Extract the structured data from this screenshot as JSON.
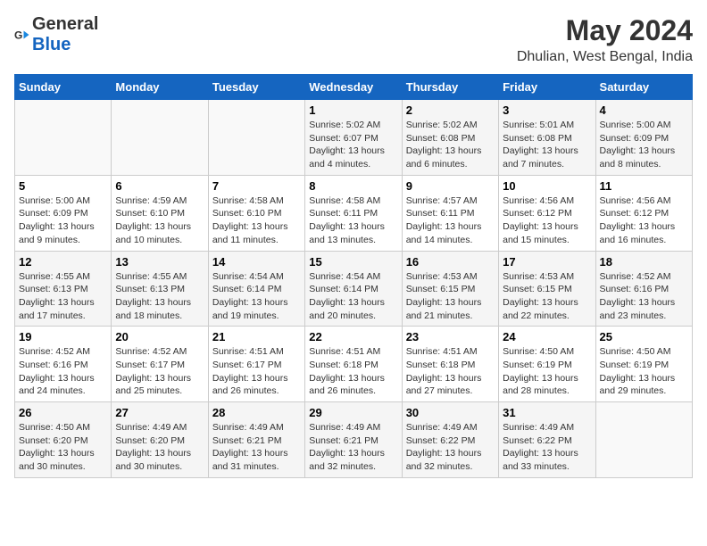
{
  "logo": {
    "line1": "General",
    "line2": "Blue"
  },
  "title": "May 2024",
  "subtitle": "Dhulian, West Bengal, India",
  "days_of_week": [
    "Sunday",
    "Monday",
    "Tuesday",
    "Wednesday",
    "Thursday",
    "Friday",
    "Saturday"
  ],
  "weeks": [
    [
      {
        "day": "",
        "info": ""
      },
      {
        "day": "",
        "info": ""
      },
      {
        "day": "",
        "info": ""
      },
      {
        "day": "1",
        "sunrise": "Sunrise: 5:02 AM",
        "sunset": "Sunset: 6:07 PM",
        "daylight": "Daylight: 13 hours and 4 minutes."
      },
      {
        "day": "2",
        "sunrise": "Sunrise: 5:02 AM",
        "sunset": "Sunset: 6:08 PM",
        "daylight": "Daylight: 13 hours and 6 minutes."
      },
      {
        "day": "3",
        "sunrise": "Sunrise: 5:01 AM",
        "sunset": "Sunset: 6:08 PM",
        "daylight": "Daylight: 13 hours and 7 minutes."
      },
      {
        "day": "4",
        "sunrise": "Sunrise: 5:00 AM",
        "sunset": "Sunset: 6:09 PM",
        "daylight": "Daylight: 13 hours and 8 minutes."
      }
    ],
    [
      {
        "day": "5",
        "sunrise": "Sunrise: 5:00 AM",
        "sunset": "Sunset: 6:09 PM",
        "daylight": "Daylight: 13 hours and 9 minutes."
      },
      {
        "day": "6",
        "sunrise": "Sunrise: 4:59 AM",
        "sunset": "Sunset: 6:10 PM",
        "daylight": "Daylight: 13 hours and 10 minutes."
      },
      {
        "day": "7",
        "sunrise": "Sunrise: 4:58 AM",
        "sunset": "Sunset: 6:10 PM",
        "daylight": "Daylight: 13 hours and 11 minutes."
      },
      {
        "day": "8",
        "sunrise": "Sunrise: 4:58 AM",
        "sunset": "Sunset: 6:11 PM",
        "daylight": "Daylight: 13 hours and 13 minutes."
      },
      {
        "day": "9",
        "sunrise": "Sunrise: 4:57 AM",
        "sunset": "Sunset: 6:11 PM",
        "daylight": "Daylight: 13 hours and 14 minutes."
      },
      {
        "day": "10",
        "sunrise": "Sunrise: 4:56 AM",
        "sunset": "Sunset: 6:12 PM",
        "daylight": "Daylight: 13 hours and 15 minutes."
      },
      {
        "day": "11",
        "sunrise": "Sunrise: 4:56 AM",
        "sunset": "Sunset: 6:12 PM",
        "daylight": "Daylight: 13 hours and 16 minutes."
      }
    ],
    [
      {
        "day": "12",
        "sunrise": "Sunrise: 4:55 AM",
        "sunset": "Sunset: 6:13 PM",
        "daylight": "Daylight: 13 hours and 17 minutes."
      },
      {
        "day": "13",
        "sunrise": "Sunrise: 4:55 AM",
        "sunset": "Sunset: 6:13 PM",
        "daylight": "Daylight: 13 hours and 18 minutes."
      },
      {
        "day": "14",
        "sunrise": "Sunrise: 4:54 AM",
        "sunset": "Sunset: 6:14 PM",
        "daylight": "Daylight: 13 hours and 19 minutes."
      },
      {
        "day": "15",
        "sunrise": "Sunrise: 4:54 AM",
        "sunset": "Sunset: 6:14 PM",
        "daylight": "Daylight: 13 hours and 20 minutes."
      },
      {
        "day": "16",
        "sunrise": "Sunrise: 4:53 AM",
        "sunset": "Sunset: 6:15 PM",
        "daylight": "Daylight: 13 hours and 21 minutes."
      },
      {
        "day": "17",
        "sunrise": "Sunrise: 4:53 AM",
        "sunset": "Sunset: 6:15 PM",
        "daylight": "Daylight: 13 hours and 22 minutes."
      },
      {
        "day": "18",
        "sunrise": "Sunrise: 4:52 AM",
        "sunset": "Sunset: 6:16 PM",
        "daylight": "Daylight: 13 hours and 23 minutes."
      }
    ],
    [
      {
        "day": "19",
        "sunrise": "Sunrise: 4:52 AM",
        "sunset": "Sunset: 6:16 PM",
        "daylight": "Daylight: 13 hours and 24 minutes."
      },
      {
        "day": "20",
        "sunrise": "Sunrise: 4:52 AM",
        "sunset": "Sunset: 6:17 PM",
        "daylight": "Daylight: 13 hours and 25 minutes."
      },
      {
        "day": "21",
        "sunrise": "Sunrise: 4:51 AM",
        "sunset": "Sunset: 6:17 PM",
        "daylight": "Daylight: 13 hours and 26 minutes."
      },
      {
        "day": "22",
        "sunrise": "Sunrise: 4:51 AM",
        "sunset": "Sunset: 6:18 PM",
        "daylight": "Daylight: 13 hours and 26 minutes."
      },
      {
        "day": "23",
        "sunrise": "Sunrise: 4:51 AM",
        "sunset": "Sunset: 6:18 PM",
        "daylight": "Daylight: 13 hours and 27 minutes."
      },
      {
        "day": "24",
        "sunrise": "Sunrise: 4:50 AM",
        "sunset": "Sunset: 6:19 PM",
        "daylight": "Daylight: 13 hours and 28 minutes."
      },
      {
        "day": "25",
        "sunrise": "Sunrise: 4:50 AM",
        "sunset": "Sunset: 6:19 PM",
        "daylight": "Daylight: 13 hours and 29 minutes."
      }
    ],
    [
      {
        "day": "26",
        "sunrise": "Sunrise: 4:50 AM",
        "sunset": "Sunset: 6:20 PM",
        "daylight": "Daylight: 13 hours and 30 minutes."
      },
      {
        "day": "27",
        "sunrise": "Sunrise: 4:49 AM",
        "sunset": "Sunset: 6:20 PM",
        "daylight": "Daylight: 13 hours and 30 minutes."
      },
      {
        "day": "28",
        "sunrise": "Sunrise: 4:49 AM",
        "sunset": "Sunset: 6:21 PM",
        "daylight": "Daylight: 13 hours and 31 minutes."
      },
      {
        "day": "29",
        "sunrise": "Sunrise: 4:49 AM",
        "sunset": "Sunset: 6:21 PM",
        "daylight": "Daylight: 13 hours and 32 minutes."
      },
      {
        "day": "30",
        "sunrise": "Sunrise: 4:49 AM",
        "sunset": "Sunset: 6:22 PM",
        "daylight": "Daylight: 13 hours and 32 minutes."
      },
      {
        "day": "31",
        "sunrise": "Sunrise: 4:49 AM",
        "sunset": "Sunset: 6:22 PM",
        "daylight": "Daylight: 13 hours and 33 minutes."
      },
      {
        "day": "",
        "info": ""
      }
    ]
  ]
}
